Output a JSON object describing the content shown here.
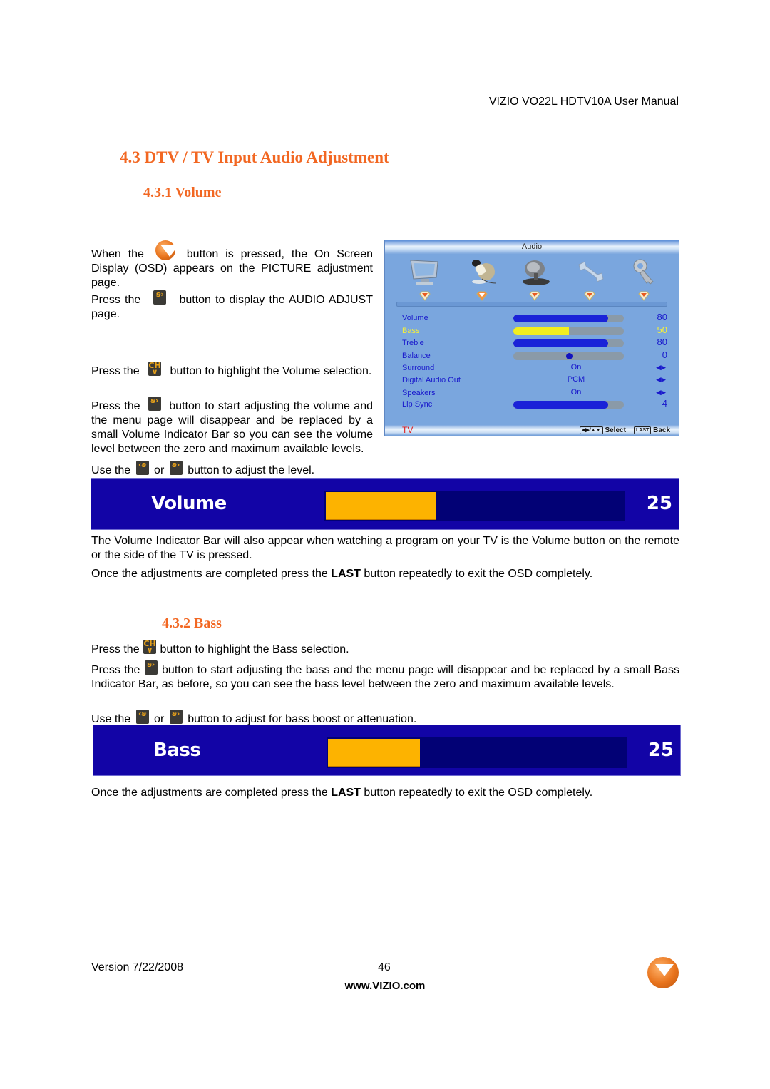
{
  "header": {
    "manual_title": "VIZIO VO22L HDTV10A User Manual"
  },
  "section": {
    "title": "4.3 DTV / TV Input Audio Adjustment",
    "volume": {
      "title": "4.3.1 Volume",
      "p1_a": "When the",
      "p1_b": "button is pressed, the On Screen Display (OSD) appears on the PICTURE adjustment page.",
      "p2_a": "Press the",
      "p2_b": "button to display the AUDIO ADJUST page.",
      "p3_a": "Press the",
      "p3_b": "button to highlight the Volume selection.",
      "p4_a": "Press the",
      "p4_b": "button to start adjusting the volume and the menu page will disappear and be replaced by a small Volume Indicator Bar so you can see the volume level between the zero and maximum available levels.",
      "p5_a": "Use the",
      "p5_or": "or",
      "p5_b": "button to adjust the level.",
      "p6": "The Volume Indicator Bar will also appear when watching a program on your TV is the Volume button on the remote or the side of the TV is pressed.",
      "p7_a": "Once the adjustments are completed press the",
      "p7_bold": "LAST",
      "p7_b": "button repeatedly to exit the OSD completely."
    },
    "bass": {
      "title": "4.3.2 Bass",
      "p1_a": "Press the",
      "p1_b": "button to highlight the Bass selection.",
      "p2_a": "Press the",
      "p2_b": "button to start adjusting the bass and the menu page will disappear and be replaced by a small Bass Indicator Bar, as before, so you can see the bass level between the zero and maximum available levels.",
      "p3_a": "Use the",
      "p3_or": "or",
      "p3_b": "button to adjust for bass boost or attenuation.",
      "p4_a": "Once the adjustments are completed press the",
      "p4_bold": "LAST",
      "p4_b": "button repeatedly to exit the OSD completely."
    }
  },
  "buttons": {
    "menu": "vizio-v-button-icon",
    "right": {
      "icon": "volume-right-button-icon",
      "glyph": "ꞩ›"
    },
    "left": {
      "icon": "volume-left-button-icon",
      "glyph": "‹ꞩ"
    },
    "ch_down": {
      "icon": "channel-down-button-icon",
      "glyph": "CH\n∨"
    }
  },
  "osd": {
    "title": "Audio",
    "tabs": [
      {
        "icon": "picture-monitor-icon"
      },
      {
        "icon": "audio-microphone-icon",
        "active": true
      },
      {
        "icon": "tv-satellite-dish-icon"
      },
      {
        "icon": "setup-wrench-icon"
      },
      {
        "icon": "parental-key-icon"
      }
    ],
    "rows": [
      {
        "label": "Volume",
        "type": "bar",
        "value": "80",
        "level": 0.86
      },
      {
        "label": "Bass",
        "type": "bar",
        "value": "50",
        "level": 0.5,
        "highlighted": true
      },
      {
        "label": "Treble",
        "type": "bar",
        "value": "80",
        "level": 0.86
      },
      {
        "label": "Balance",
        "type": "center",
        "value": "0",
        "level": 0.5
      },
      {
        "label": "Surround",
        "type": "option",
        "option": "On"
      },
      {
        "label": "Digital Audio Out",
        "type": "option",
        "option": "PCM"
      },
      {
        "label": "Speakers",
        "type": "option",
        "option": "On"
      },
      {
        "label": "Lip Sync",
        "type": "bar",
        "value": "4",
        "level": 0.86
      }
    ],
    "lr_glyph": "◀▶",
    "footer": {
      "input": "TV",
      "nav_key": "◀▶/▲▼",
      "select": "Select",
      "last_key": "LAST",
      "back": "Back"
    }
  },
  "volume_indicator": {
    "label": "Volume",
    "value": "25",
    "level": 0.37
  },
  "bass_indicator": {
    "label": "Bass",
    "value": "25",
    "level": 0.31
  },
  "footer": {
    "version": "Version 7/22/2008",
    "page": "46",
    "url": "www.VIZIO.com"
  },
  "colors": {
    "heading": "#f26722",
    "osd_bg": "#7aa6de",
    "osd_text": "#1a1acc",
    "osd_highlight": "#f5f03a",
    "indicator_bg": "#1204a6",
    "indicator_fill": "#fdb300"
  }
}
